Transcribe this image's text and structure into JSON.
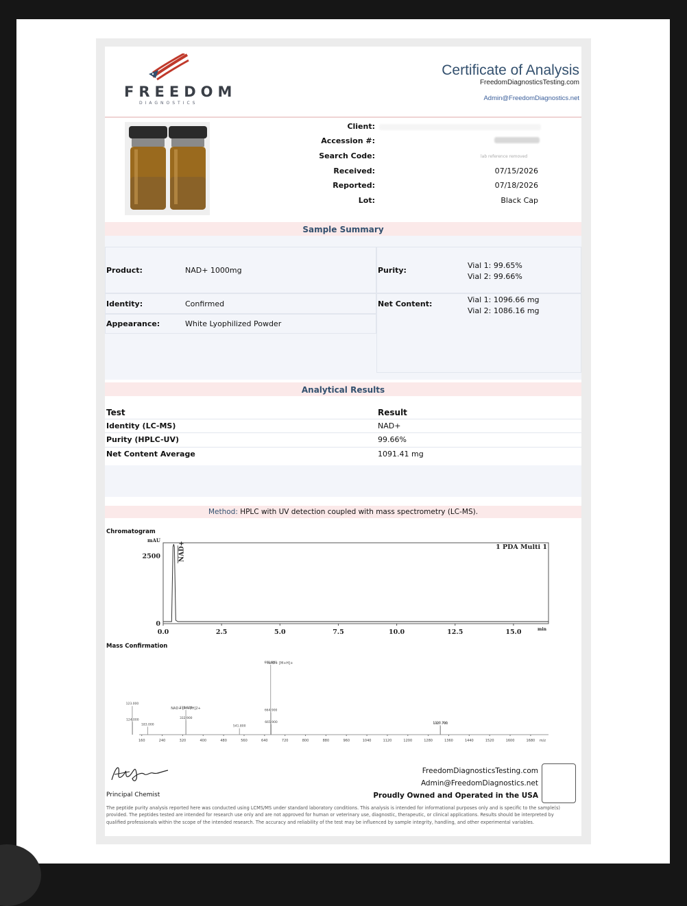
{
  "header": {
    "brand_name": "FREEDOM",
    "brand_sub": "DIAGNOSTICS",
    "title": "Certificate of Analysis",
    "website": "FreedomDiagnosticsTesting.com",
    "email": "Admin@FreedomDiagnostics.net"
  },
  "client_info": {
    "client_label": "Client:",
    "accession_label": "Accession #:",
    "search_code_label": "Search Code:",
    "search_code_note": "lab reference removed",
    "received_label": "Received:",
    "received_value": "07/15/2026",
    "reported_label": "Reported:",
    "reported_value": "07/18/2026",
    "lot_label": "Lot:",
    "lot_value": "Black Cap"
  },
  "sample_summary": {
    "title": "Sample Summary",
    "product_label": "Product:",
    "product_value": "NAD+ 1000mg",
    "purity_label": "Purity:",
    "purity_vial1": "Vial 1: 99.65%",
    "purity_vial2": "Vial 2: 99.66%",
    "identity_label": "Identity:",
    "identity_value": "Confirmed",
    "net_content_label": "Net Content:",
    "net_vial1": "Vial 1: 1096.66 mg",
    "net_vial2": "Vial 2: 1086.16 mg",
    "appearance_label": "Appearance:",
    "appearance_value": "White Lyophilized Powder"
  },
  "analytical_results": {
    "title": "Analytical Results",
    "test_header": "Test",
    "result_header": "Result",
    "rows": [
      {
        "test": "Identity (LC-MS)",
        "result": "NAD+"
      },
      {
        "test": "Purity (HPLC-UV)",
        "result": "99.66%"
      },
      {
        "test": "Net Content Average",
        "result": "1091.41 mg"
      }
    ]
  },
  "method": {
    "label": "Method:",
    "text": "HPLC with UV detection coupled with mass spectrometry (LC-MS)."
  },
  "chart_data": [
    {
      "type": "line",
      "title": "Chromatogram",
      "detector": "1 PDA Multi 1",
      "ylabel": "mAU",
      "xlabel": "min",
      "xlim": [
        0,
        16.5
      ],
      "ylim": [
        0,
        3000
      ],
      "x_ticks": [
        "0.0",
        "2.5",
        "5.0",
        "7.5",
        "10.0",
        "12.5",
        "15.0"
      ],
      "y_ticks": [
        "0",
        "2500"
      ],
      "peaks": [
        {
          "label": "NAD+",
          "x": 0.45,
          "y": 2950
        }
      ]
    },
    {
      "type": "bar",
      "title": "Mass Confirmation",
      "xlabel": "m/z",
      "xlim": [
        150,
        1750
      ],
      "x_ticks": [
        "160",
        "240",
        "320",
        "400",
        "480",
        "560",
        "640",
        "720",
        "800",
        "880",
        "960",
        "1040",
        "1120",
        "1200",
        "1280",
        "1360",
        "1440",
        "1520",
        "1600",
        "1680"
      ],
      "peaks": [
        {
          "mz": 123.0,
          "label": "123.000",
          "intensity": 0.36
        },
        {
          "mz": 124.0,
          "label": "124.000",
          "intensity": 0.16
        },
        {
          "mz": 183.0,
          "label": "183.000",
          "intensity": 0.1
        },
        {
          "mz": 332.4,
          "label": "332.400",
          "intensity": 0.31
        },
        {
          "mz": 332.9,
          "label": "332.900",
          "intensity": 0.18
        },
        {
          "mz": 541.8,
          "label": "541.800",
          "intensity": 0.08
        },
        {
          "mz": 663.9,
          "label": "663.900",
          "intensity": 0.88
        },
        {
          "mz": 664.9,
          "label": "664.900",
          "intensity": 0.28
        },
        {
          "mz": 665.9,
          "label": "665.900",
          "intensity": 0.13
        },
        {
          "mz": 1326.7,
          "label": "1326.700",
          "intensity": 0.12
        },
        {
          "mz": 1327.7,
          "label": "1327.700",
          "intensity": 0.11
        }
      ],
      "annotations": [
        {
          "label": "NAD+ [M+H]+",
          "mz": 663.9
        },
        {
          "label": "NAD+ [M+2H]2+",
          "mz": 332.4
        }
      ]
    }
  ],
  "footer": {
    "signature_name": "Alex Johnson",
    "role": "Principal Chemist",
    "website": "FreedomDiagnosticsTesting.com",
    "email": "Admin@FreedomDiagnostics.net",
    "tagline": "Proudly Owned and Operated in the USA",
    "disclaimer": "The peptide purity analysis reported here was conducted using LCMS/MS under standard laboratory conditions. This analysis is intended for informational purposes only and is specific to the sample(s) provided. The peptides tested are intended for research use only and are not approved for human or veterinary use, diagnostic, therapeutic, or clinical applications. Results should be interpreted by qualified professionals within the scope of the intended research. The accuracy and reliability of the test may be influenced by sample integrity, handling, and other experimental variables."
  },
  "colors": {
    "accent_blue": "#33506e",
    "link_blue": "#3a5e9a",
    "section_pink": "#fbe9e9",
    "panel_light": "#f3f5fa"
  }
}
